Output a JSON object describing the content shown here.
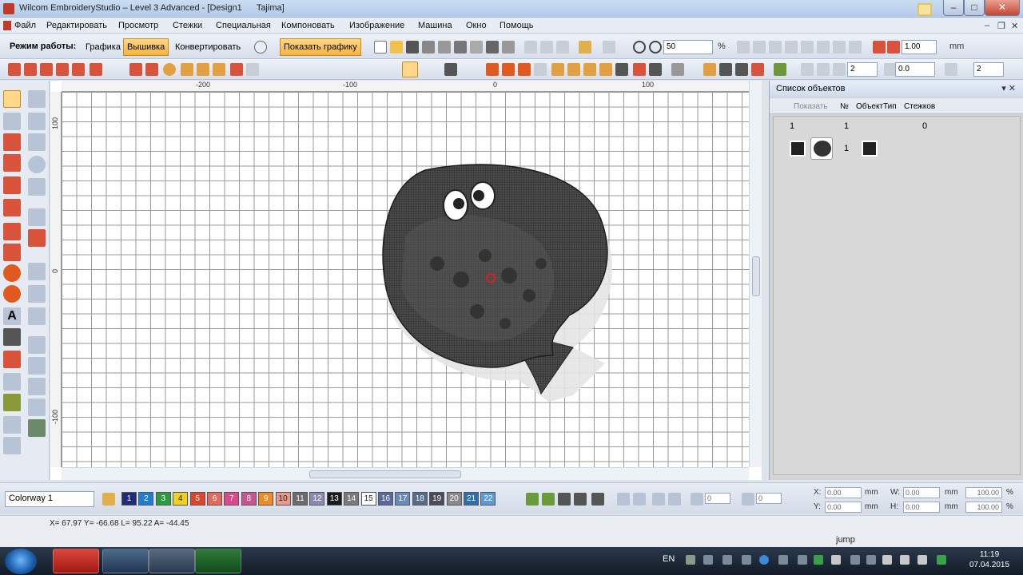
{
  "window": {
    "title": "Wilcom EmbroideryStudio – Level 3 Advanced - [Design1",
    "subtitle": "Tajima]",
    "min_label": "–",
    "max_label": "□",
    "close_label": "✕"
  },
  "menu": {
    "items": [
      "Файл",
      "Редактировать",
      "Просмотр",
      "Стежки",
      "Специальная",
      "Компоновать",
      "Изображение",
      "Машина",
      "Окно",
      "Помощь"
    ],
    "mdi_min": "–",
    "mdi_restore": "❐",
    "mdi_close": "✕"
  },
  "toolbar": {
    "mode_label": "Режим работы:",
    "mode_graphics": "Графика",
    "mode_embroidery": "Вышивка",
    "mode_convert": "Конвертировать",
    "show_graphics": "Показать графику",
    "zoom_value": "50",
    "zoom_unit": "%",
    "stitch_length": "1.00",
    "stitch_unit": "mm",
    "field_a": "0.0",
    "spin_a": "2",
    "spin_b": "2"
  },
  "rulers": {
    "top": [
      "-200",
      "-100",
      "0",
      "100"
    ],
    "left": [
      "100",
      "0",
      "-100"
    ]
  },
  "object_panel": {
    "title": "Список объектов",
    "pin": "▾ ✕",
    "columns": {
      "show": "Показать",
      "no": "№",
      "object": "Объект",
      "type": "Тип",
      "stitches": "Стежков"
    },
    "group_row": {
      "no": "1",
      "col2": "1",
      "stitches": "0"
    },
    "item_row": {
      "no": "1"
    }
  },
  "bottom": {
    "colorway": "Colorway 1",
    "swatches": [
      {
        "n": "1",
        "color": "#1f2d78"
      },
      {
        "n": "2",
        "color": "#1e7bd6"
      },
      {
        "n": "3",
        "color": "#2c9a3e"
      },
      {
        "n": "4",
        "color": "#f0d21e"
      },
      {
        "n": "5",
        "color": "#e0452b"
      },
      {
        "n": "6",
        "color": "#e06a5c"
      },
      {
        "n": "7",
        "color": "#d94a8c"
      },
      {
        "n": "8",
        "color": "#c7568f"
      },
      {
        "n": "9",
        "color": "#f08a24"
      },
      {
        "n": "10",
        "color": "#e89a8a"
      },
      {
        "n": "11",
        "color": "#6b6b6b"
      },
      {
        "n": "12",
        "color": "#8a8ab4"
      },
      {
        "n": "13",
        "color": "#1b1b1b"
      },
      {
        "n": "14",
        "color": "#7a7a7a"
      },
      {
        "n": "15",
        "color": "#ffffff"
      },
      {
        "n": "16",
        "color": "#5a6a9a"
      },
      {
        "n": "17",
        "color": "#6a8ab8"
      },
      {
        "n": "18",
        "color": "#556b8a"
      },
      {
        "n": "19",
        "color": "#4a4a5a"
      },
      {
        "n": "20",
        "color": "#8a8a8a"
      },
      {
        "n": "21",
        "color": "#2f6fb0"
      },
      {
        "n": "22",
        "color": "#5a9ad6"
      }
    ],
    "x_label": "X:",
    "y_label": "Y:",
    "w_label": "W:",
    "h_label": "H:",
    "x_value": "0.00",
    "y_value": "0.00",
    "w_value": "0.00",
    "h_value": "0.00",
    "unit": "mm",
    "pct_w": "100.00",
    "pct_h": "100.00",
    "pct_unit": "%",
    "rot_value": "0",
    "skew_value": "0"
  },
  "status": {
    "coords": "X= 67.97 Y= -66.68 L= 95.22 A= -44.45",
    "message": "jump"
  },
  "taskbar": {
    "lang": "EN",
    "time": "11:19",
    "date": "07.04.2015"
  }
}
